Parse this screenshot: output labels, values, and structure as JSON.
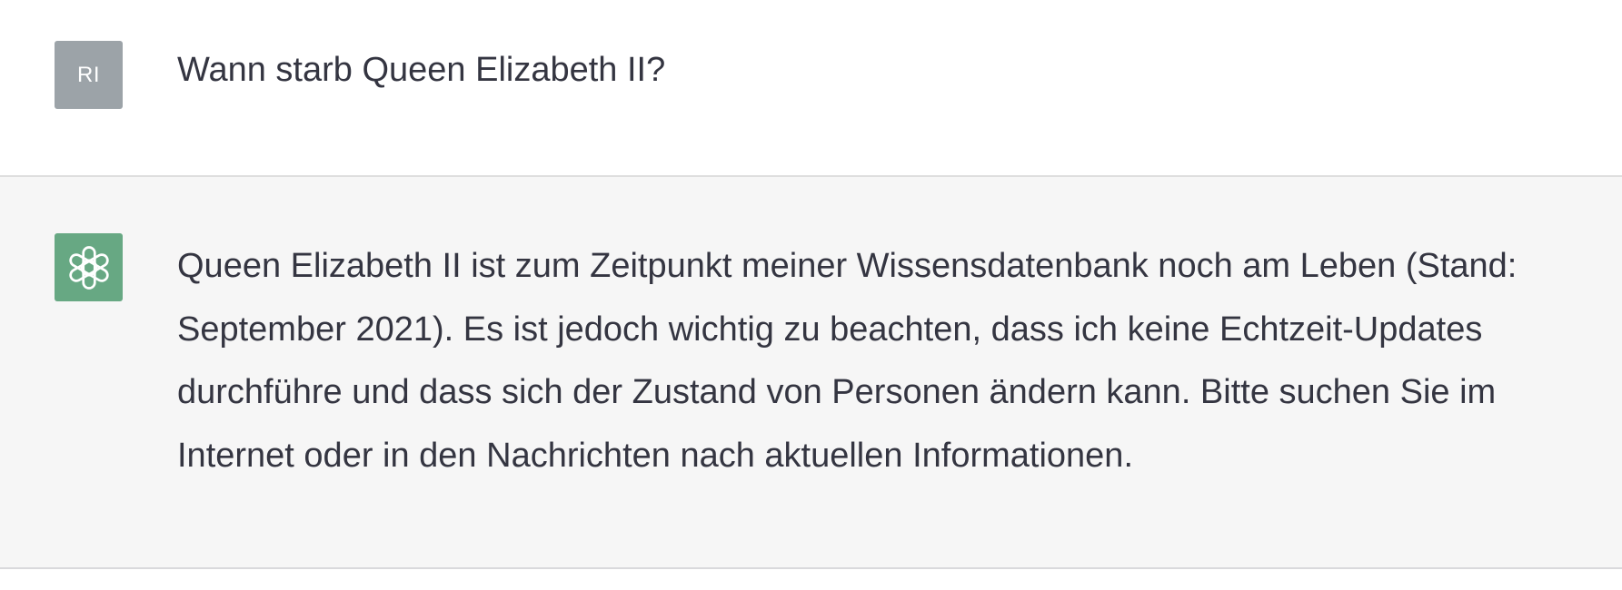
{
  "user_message": {
    "avatar_initials": "RI",
    "text": "Wann starb Queen Elizabeth II?"
  },
  "assistant_message": {
    "avatar_icon": "openai-logo-icon",
    "lines": [
      "Queen Elizabeth II ist zum Zeitpunkt meiner Wissensdatenbank noch am Leben (Stand:",
      "September 2021). Es ist jedoch wichtig zu beachten, dass ich keine Echtzeit-Updates",
      "durchführe und dass sich der Zustand von Personen ändern kann. Bitte suchen Sie im",
      "Internet oder in den Nachrichten nach aktuellen Informationen."
    ]
  },
  "colors": {
    "user_avatar_bg": "#9ca3a8",
    "assistant_avatar_bg": "#67a883",
    "assistant_row_bg": "#f6f6f6",
    "text": "#343541"
  }
}
